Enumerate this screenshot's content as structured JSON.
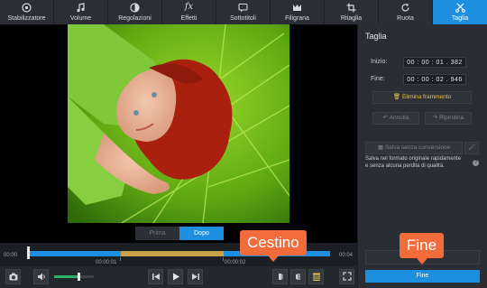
{
  "toolbar": {
    "tabs": [
      {
        "label": "Stabilizzatore",
        "icon": "stabilizer-icon"
      },
      {
        "label": "Volume",
        "icon": "music-note-icon"
      },
      {
        "label": "Regolazioni",
        "icon": "adjustments-icon"
      },
      {
        "label": "Effetti",
        "icon": "fx-icon"
      },
      {
        "label": "Sottotitoli",
        "icon": "subtitle-icon"
      },
      {
        "label": "Filigrana",
        "icon": "watermark-icon"
      },
      {
        "label": "Ritaglia",
        "icon": "crop-icon"
      },
      {
        "label": "Ruota",
        "icon": "rotate-icon"
      },
      {
        "label": "Taglia",
        "icon": "scissors-icon",
        "active": true
      }
    ],
    "active_color": "#1e8fe0"
  },
  "preview": {
    "before_label": "Prima",
    "after_label": "Dopo"
  },
  "panel": {
    "title": "Taglia",
    "start_label": "Inizio:",
    "start_value": "00 : 00 : 01 . 382",
    "end_label": "Fine:",
    "end_value": "00 : 00 : 02 . 946",
    "delete_label": "Elimina frammento",
    "undo_label": "Annulla",
    "redo_label": "Ripristina",
    "save_label": "Salva senza conversione",
    "note": "Salva nel formato originale rapidamente e senza alcuna perdita di qualità.",
    "help": "?",
    "done_label": "Fine"
  },
  "timeline": {
    "start_time": "00:00",
    "end_time": "00:04",
    "mark1": "00:00:01",
    "mark2": "00:00:02"
  },
  "volume_level": 0.62,
  "callouts": {
    "trash": "Cestino",
    "done": "Fine"
  },
  "colors": {
    "accent": "#1e8fe0",
    "segment": "#c7a24a",
    "callout": "#f26b3a"
  }
}
